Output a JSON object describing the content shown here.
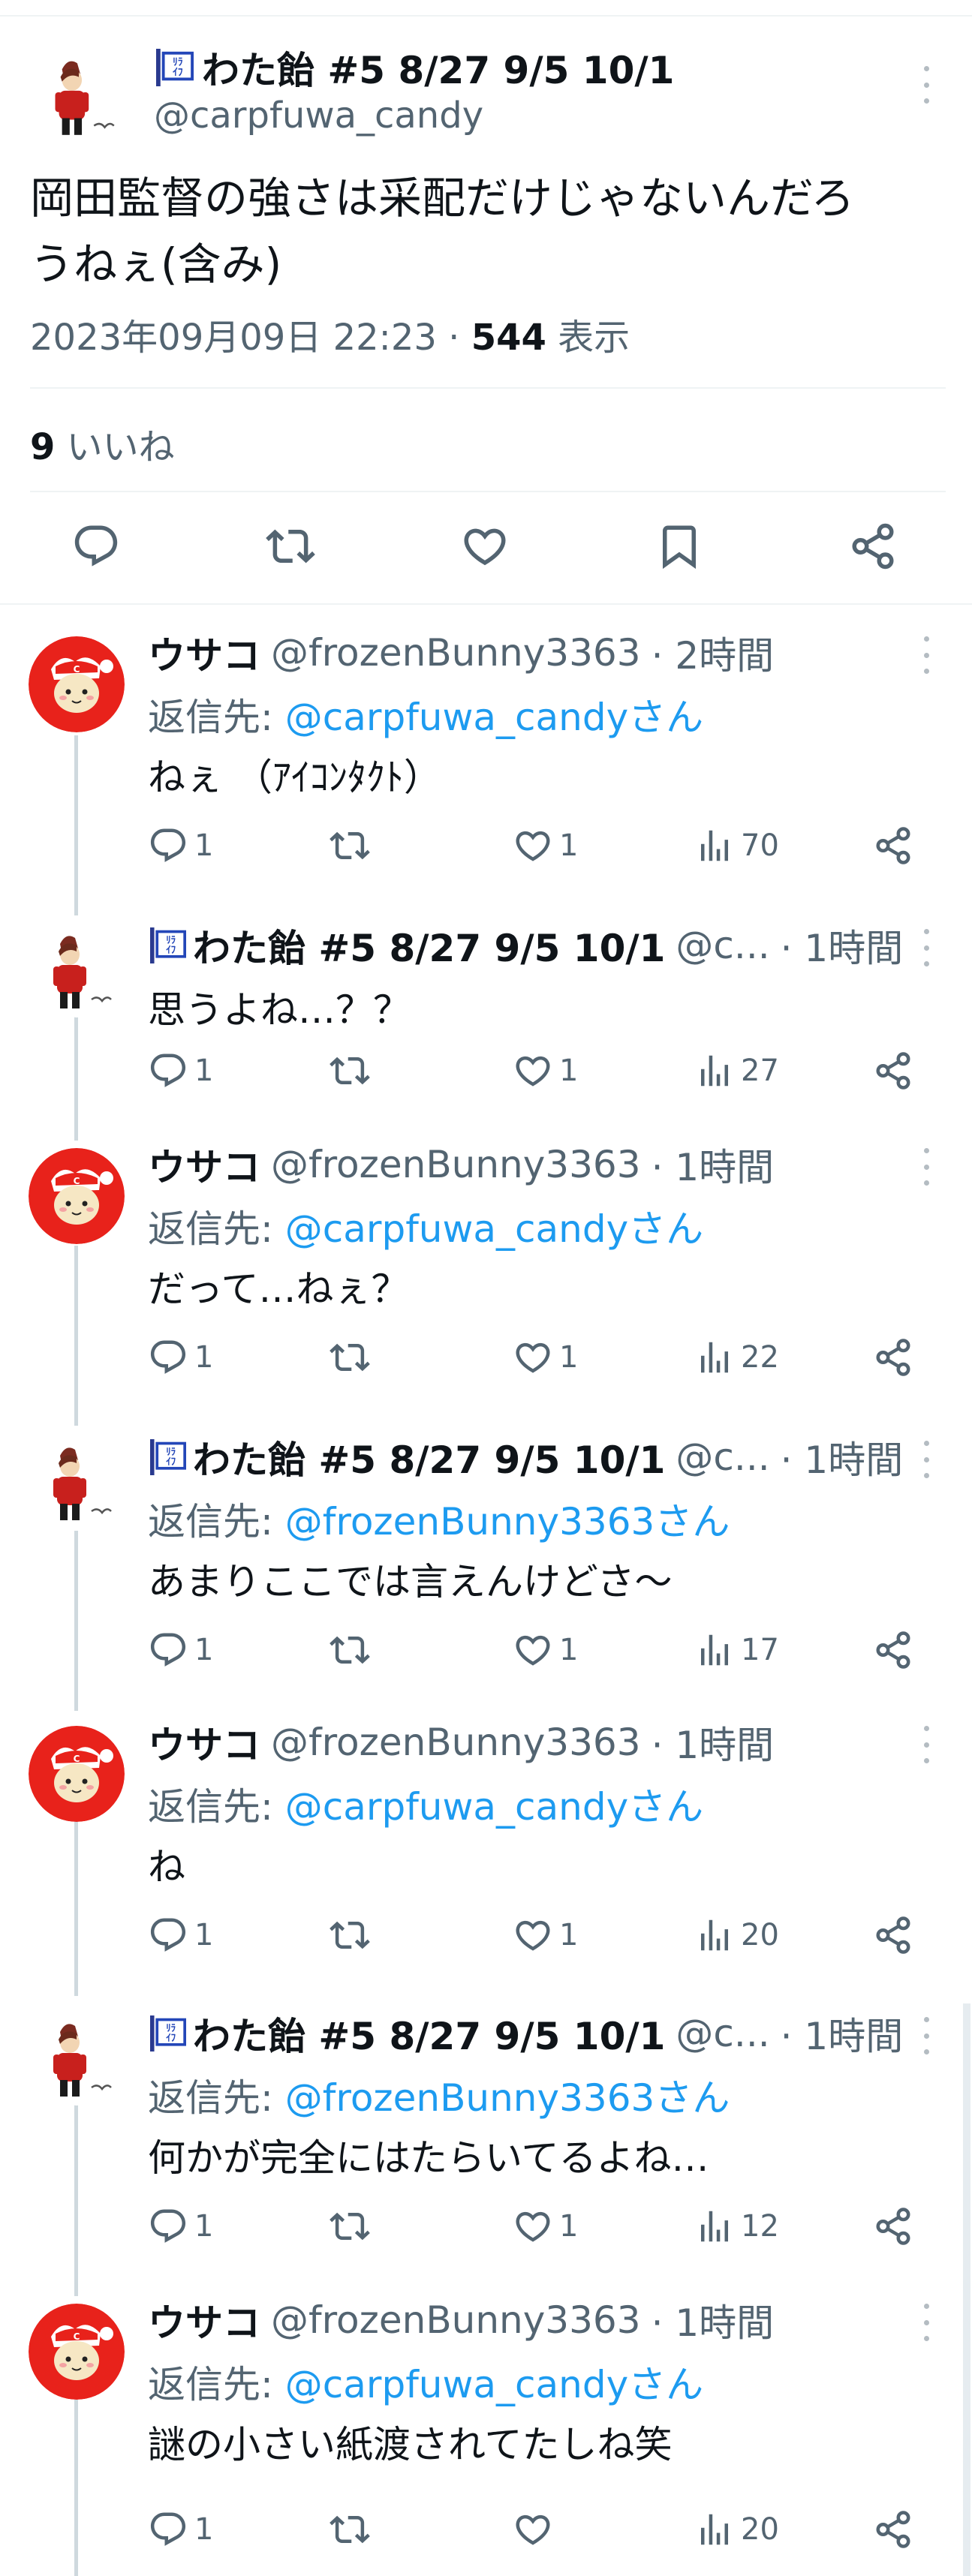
{
  "main": {
    "name": "わた飴 #5 8/27 9/5 10/1",
    "handle": "@carpfuwa_candy",
    "text_line1": "岡田監督の強さは采配だけじゃないんだろ",
    "text_line2": "うねぇ(含み)",
    "datetime": "2023年09月09日 22:23",
    "sep": "·",
    "views_count": "544",
    "views_label": "表示",
    "likes_count": "9",
    "likes_label": "いいね"
  },
  "reply_to_label": "返信先:",
  "replies": [
    {
      "name": "ウサコ",
      "handle": "@frozenBunny3363",
      "time": "· 2時間",
      "reply_to": "@carpfuwa_candyさん",
      "text": "ねぇ （ｱｲｺﾝﾀｸﾄ）",
      "replies": "1",
      "likes": "1",
      "views": "70"
    },
    {
      "name": "わた飴 #5 8/27 9/5 10/1",
      "handle": "@c",
      "ellipsis": "...",
      "time": "· 1時間",
      "text": "思うよね…？？",
      "replies": "1",
      "likes": "1",
      "views": "27"
    },
    {
      "name": "ウサコ",
      "handle": "@frozenBunny3363",
      "time": "· 1時間",
      "reply_to": "@carpfuwa_candyさん",
      "text": "だって…ねぇ？",
      "replies": "1",
      "likes": "1",
      "views": "22"
    },
    {
      "name": "わた飴 #5 8/27 9/5 10/1",
      "handle": "@c",
      "ellipsis": "...",
      "time": "· 1時間",
      "reply_to": "@frozenBunny3363さん",
      "text": "あまりここでは言えんけどさ〜",
      "replies": "1",
      "likes": "1",
      "views": "17"
    },
    {
      "name": "ウサコ",
      "handle": "@frozenBunny3363",
      "time": "· 1時間",
      "reply_to": "@carpfuwa_candyさん",
      "text": "ね",
      "replies": "1",
      "likes": "1",
      "views": "20"
    },
    {
      "name": "わた飴 #5 8/27 9/5 10/1",
      "handle": "@c",
      "ellipsis": "...",
      "time": "· 1時間",
      "reply_to": "@frozenBunny3363さん",
      "text": "何かが完全にはたらいてるよね…",
      "replies": "1",
      "likes": "1",
      "views": "12"
    },
    {
      "name": "ウサコ",
      "handle": "@frozenBunny3363",
      "time": "· 1時間",
      "reply_to": "@carpfuwa_candyさん",
      "text": "謎の小さい紙渡されてたしね笑",
      "replies": "1",
      "likes": "",
      "views": "20"
    }
  ],
  "colors": {
    "link": "#1d9bf0",
    "secondary": "#536471",
    "primary": "#0f1419",
    "thread_line": "#cfd9de",
    "avatar_red": "#e8221b"
  },
  "icons": [
    "reply-icon",
    "retweet-icon",
    "like-icon",
    "bookmark-icon",
    "share-icon",
    "views-icon",
    "more-icon",
    "flag-icon"
  ]
}
